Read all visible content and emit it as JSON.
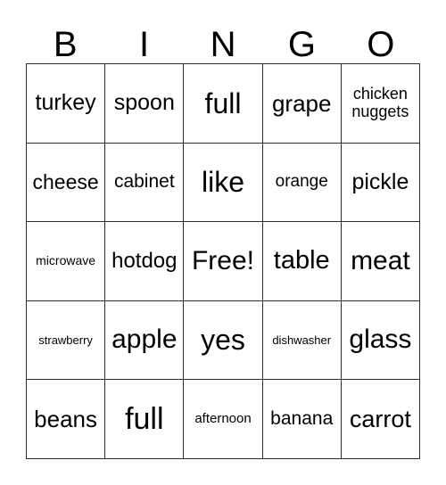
{
  "card": {
    "title_letters": [
      "B",
      "I",
      "N",
      "G",
      "O"
    ],
    "grid": {
      "rows": 5,
      "columns": 5,
      "border_color": "#2b2b2b",
      "background_color": "#ffffff",
      "text_color": "#000000"
    },
    "cells": [
      [
        {
          "text": "turkey",
          "size": 25
        },
        {
          "text": "spoon",
          "size": 25
        },
        {
          "text": "full",
          "size": 32
        },
        {
          "text": "grape",
          "size": 26
        },
        {
          "text": "chicken nuggets",
          "size": 18
        }
      ],
      [
        {
          "text": "cheese",
          "size": 23
        },
        {
          "text": "cabinet",
          "size": 21
        },
        {
          "text": "like",
          "size": 32
        },
        {
          "text": "orange",
          "size": 19
        },
        {
          "text": "pickle",
          "size": 25
        }
      ],
      [
        {
          "text": "microwave",
          "size": 14
        },
        {
          "text": "hotdog",
          "size": 24
        },
        {
          "text": "Free!",
          "size": 30
        },
        {
          "text": "table",
          "size": 29
        },
        {
          "text": "meat",
          "size": 30
        }
      ],
      [
        {
          "text": "strawberry",
          "size": 13
        },
        {
          "text": "apple",
          "size": 30
        },
        {
          "text": "yes",
          "size": 32
        },
        {
          "text": "dishwasher",
          "size": 13
        },
        {
          "text": "glass",
          "size": 30
        }
      ],
      [
        {
          "text": "beans",
          "size": 26
        },
        {
          "text": "full",
          "size": 34
        },
        {
          "text": "afternoon",
          "size": 15
        },
        {
          "text": "banana",
          "size": 21
        },
        {
          "text": "carrot",
          "size": 27
        }
      ]
    ]
  }
}
